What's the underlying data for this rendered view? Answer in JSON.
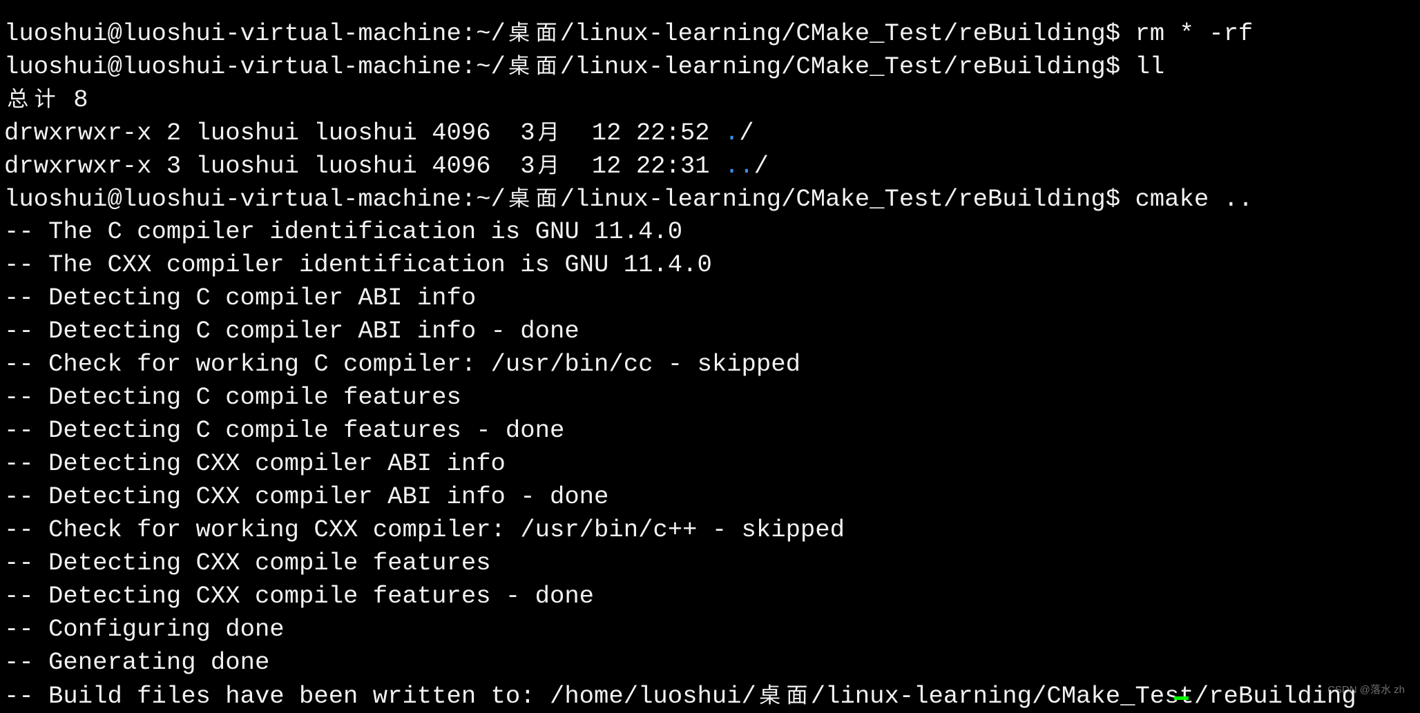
{
  "terminal": {
    "colors": {
      "background": "#000000",
      "foreground": "#f2f2f2",
      "directory": "#3b8eea",
      "cursor": "#00ff00"
    },
    "lines": [
      [
        {
          "t": ""
        }
      ],
      [
        {
          "t": "luoshui@luoshui-virtual-machine:~/桌面/linux-learning/CMake_Test/reBuilding$ rm * -rf"
        }
      ],
      [
        {
          "t": "luoshui@luoshui-virtual-machine:~/桌面/linux-learning/CMake_Test/reBuilding$ ll"
        }
      ],
      [
        {
          "t": "总计 8"
        }
      ],
      [
        {
          "t": "drwxrwxr-x 2 luoshui luoshui 4096  3月  12 22:52 "
        },
        {
          "t": ".",
          "c": "blue"
        },
        {
          "t": "/"
        }
      ],
      [
        {
          "t": "drwxrwxr-x 3 luoshui luoshui 4096  3月  12 22:31 "
        },
        {
          "t": "..",
          "c": "blue"
        },
        {
          "t": "/"
        }
      ],
      [
        {
          "t": "luoshui@luoshui-virtual-machine:~/桌面/linux-learning/CMake_Test/reBuilding$ cmake .."
        }
      ],
      [
        {
          "t": "-- The C compiler identification is GNU 11.4.0"
        }
      ],
      [
        {
          "t": "-- The CXX compiler identification is GNU 11.4.0"
        }
      ],
      [
        {
          "t": "-- Detecting C compiler ABI info"
        }
      ],
      [
        {
          "t": "-- Detecting C compiler ABI info - done"
        }
      ],
      [
        {
          "t": "-- Check for working C compiler: /usr/bin/cc - skipped"
        }
      ],
      [
        {
          "t": "-- Detecting C compile features"
        }
      ],
      [
        {
          "t": "-- Detecting C compile features - done"
        }
      ],
      [
        {
          "t": "-- Detecting CXX compiler ABI info"
        }
      ],
      [
        {
          "t": "-- Detecting CXX compiler ABI info - done"
        }
      ],
      [
        {
          "t": "-- Check for working CXX compiler: /usr/bin/c++ - skipped"
        }
      ],
      [
        {
          "t": "-- Detecting CXX compile features"
        }
      ],
      [
        {
          "t": "-- Detecting CXX compile features - done"
        }
      ],
      [
        {
          "t": "-- Configuring done"
        }
      ],
      [
        {
          "t": "-- Generating done"
        }
      ],
      [
        {
          "t": "-- Build files have been written to: /home/luoshui/桌面/linux-learning/CMake_Test/reBuilding"
        }
      ]
    ]
  },
  "watermark": "CSDN @落水 zh"
}
